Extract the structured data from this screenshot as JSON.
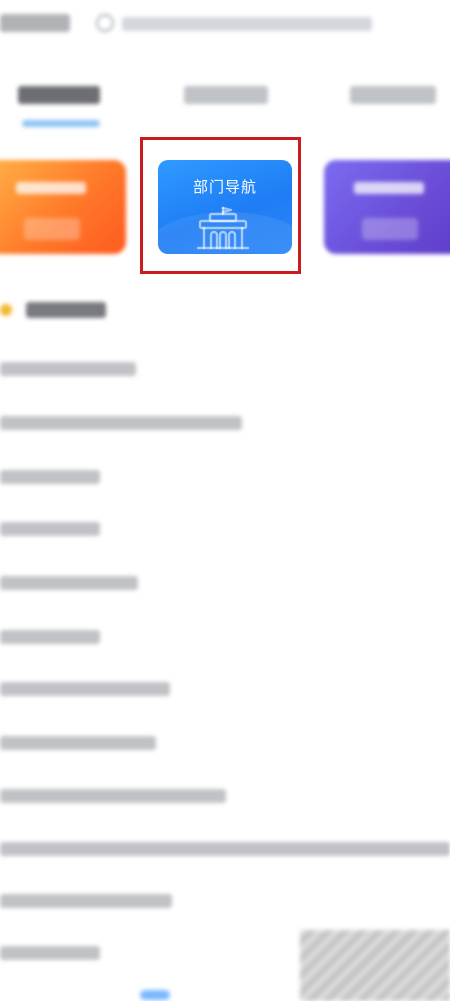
{
  "featured_card": {
    "title": "部门导航",
    "accent": "#1f7df5",
    "icon": "building-icon"
  },
  "highlight_color": "#cc1b1f",
  "section_dot_color": "#f5b82e"
}
